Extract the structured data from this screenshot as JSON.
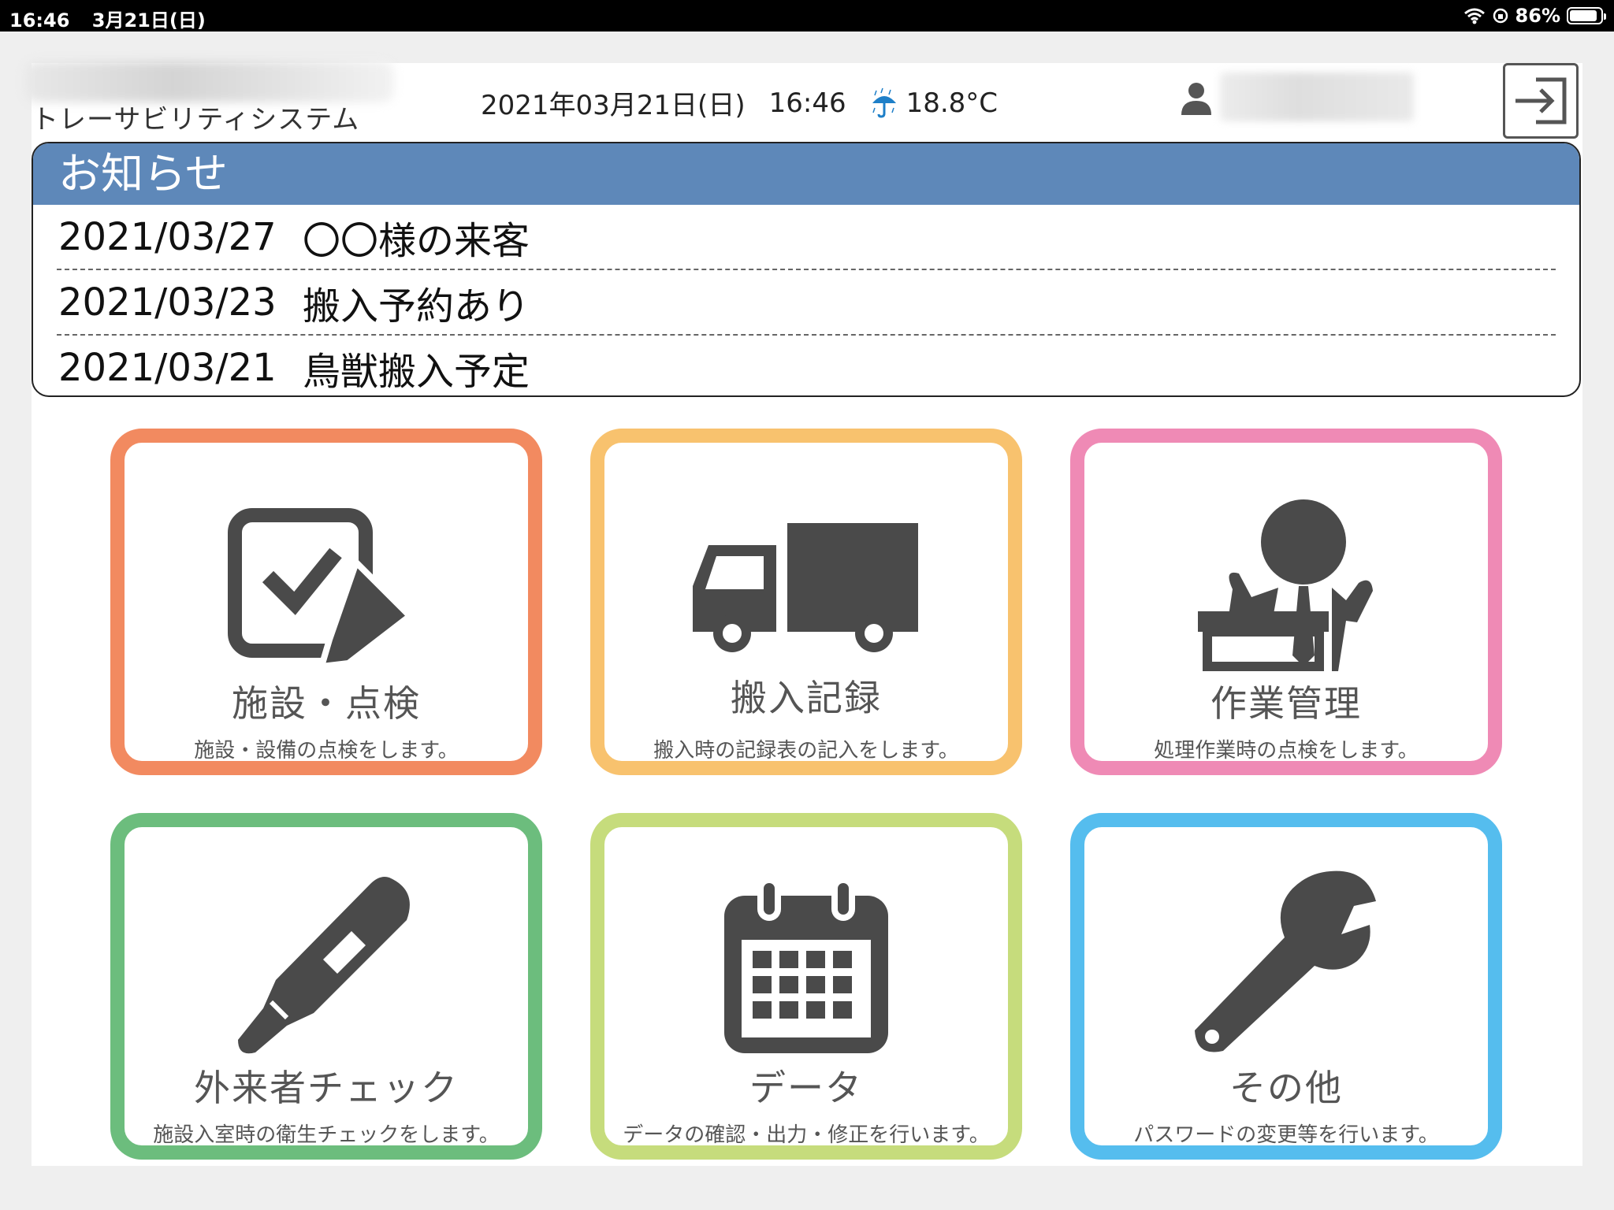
{
  "status_bar": {
    "time": "16:46",
    "date": "3月21日(日)",
    "battery": "86%"
  },
  "header": {
    "system_title": "トレーサビリティシステム",
    "date": "2021年03月21日(日)",
    "time": "16:46",
    "temperature": "18.8°C",
    "weather_icon": "umbrella-rain-icon"
  },
  "notices": {
    "title": "お知らせ",
    "items": [
      {
        "date": "2021/03/27",
        "text": "〇〇様の来客"
      },
      {
        "date": "2021/03/23",
        "text": "搬入予約あり"
      },
      {
        "date": "2021/03/21",
        "text": "鳥獣搬入予定"
      }
    ]
  },
  "menu": [
    {
      "title": "施設・点検",
      "desc": "施設・設備の点検をします。",
      "icon": "checklist-pencil-icon",
      "color": "#f28a60"
    },
    {
      "title": "搬入記録",
      "desc": "搬入時の記録表の記入をします。",
      "icon": "truck-icon",
      "color": "#f8c26e"
    },
    {
      "title": "作業管理",
      "desc": "処理作業時の点検をします。",
      "icon": "worker-icon",
      "color": "#ef8ab5"
    },
    {
      "title": "外来者チェック",
      "desc": "施設入室時の衛生チェックをします。",
      "icon": "thermometer-icon",
      "color": "#6cbd7d"
    },
    {
      "title": "データ",
      "desc": "データの確認・出力・修正を行います。",
      "icon": "calendar-icon",
      "color": "#c6dc7c"
    },
    {
      "title": "その他",
      "desc": "パスワードの変更等を行います。",
      "icon": "wrench-icon",
      "color": "#55bdee"
    }
  ]
}
